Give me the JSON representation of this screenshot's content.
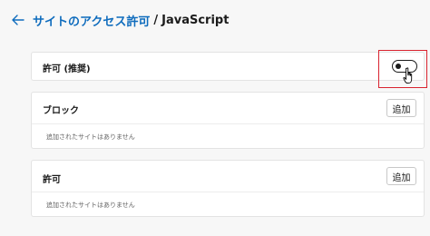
{
  "header": {
    "breadcrumb_parent": "サイトのアクセス許可",
    "separator": "/",
    "breadcrumb_current": "JavaScript"
  },
  "allow_default": {
    "label": "許可 (推奨)",
    "toggle_state": "off"
  },
  "block_section": {
    "title": "ブロック",
    "add_label": "追加",
    "empty_message": "追加されたサイトはありません"
  },
  "allow_section": {
    "title": "許可",
    "add_label": "追加",
    "empty_message": "追加されたサイトはありません"
  },
  "colors": {
    "link_blue": "#0f6cbd",
    "highlight_red": "#d9232f"
  },
  "icons": [
    "back-arrow-icon",
    "hand-pointer-icon"
  ]
}
